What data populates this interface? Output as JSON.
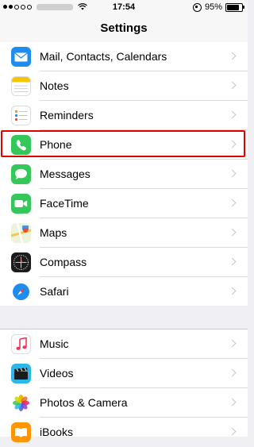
{
  "status_bar": {
    "time": "17:54",
    "battery": "95%",
    "battery_level": 0.95
  },
  "nav": {
    "title": "Settings"
  },
  "highlighted_item": "Phone",
  "settings_group_1": [
    {
      "label": "Mail, Contacts, Calendars",
      "icon": "mail-icon"
    },
    {
      "label": "Notes",
      "icon": "notes-icon"
    },
    {
      "label": "Reminders",
      "icon": "reminders-icon"
    },
    {
      "label": "Phone",
      "icon": "phone-icon"
    },
    {
      "label": "Messages",
      "icon": "messages-icon"
    },
    {
      "label": "FaceTime",
      "icon": "facetime-icon"
    },
    {
      "label": "Maps",
      "icon": "maps-icon"
    },
    {
      "label": "Compass",
      "icon": "compass-icon"
    },
    {
      "label": "Safari",
      "icon": "safari-icon"
    }
  ],
  "settings_group_2": [
    {
      "label": "Music",
      "icon": "music-icon"
    },
    {
      "label": "Videos",
      "icon": "videos-icon"
    },
    {
      "label": "Photos & Camera",
      "icon": "photos-icon"
    },
    {
      "label": "iBooks",
      "icon": "ibooks-icon"
    }
  ],
  "colors": {
    "highlight_border": "#e00000",
    "background": "#efeff4",
    "chevron": "#c7c7cc"
  }
}
